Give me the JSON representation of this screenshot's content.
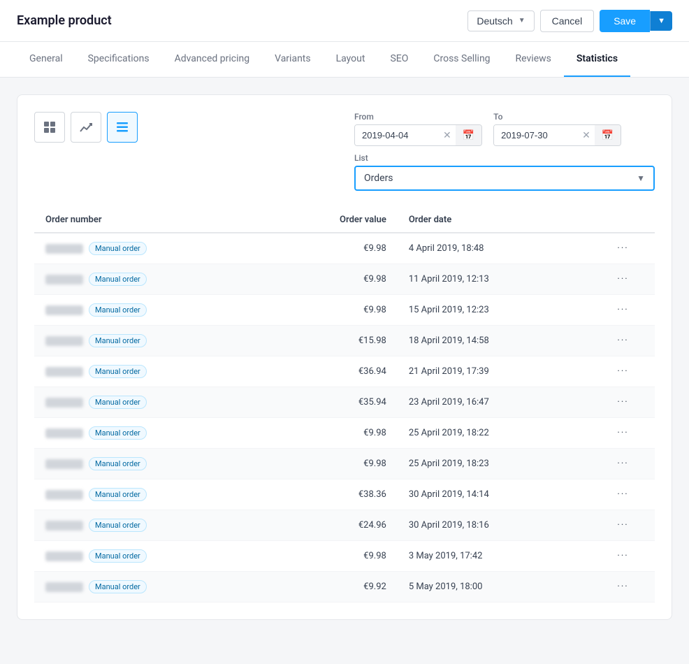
{
  "header": {
    "title": "Example product",
    "language": "Deutsch",
    "cancel_label": "Cancel",
    "save_label": "Save"
  },
  "tabs": [
    {
      "id": "general",
      "label": "General",
      "active": false
    },
    {
      "id": "specifications",
      "label": "Specifications",
      "active": false
    },
    {
      "id": "advanced-pricing",
      "label": "Advanced pricing",
      "active": false
    },
    {
      "id": "variants",
      "label": "Variants",
      "active": false
    },
    {
      "id": "layout",
      "label": "Layout",
      "active": false
    },
    {
      "id": "seo",
      "label": "SEO",
      "active": false
    },
    {
      "id": "cross-selling",
      "label": "Cross Selling",
      "active": false
    },
    {
      "id": "reviews",
      "label": "Reviews",
      "active": false
    },
    {
      "id": "statistics",
      "label": "Statistics",
      "active": true
    }
  ],
  "filters": {
    "from_label": "From",
    "to_label": "To",
    "from_value": "2019-04-04",
    "to_value": "2019-07-30",
    "list_label": "List",
    "list_value": "Orders"
  },
  "table": {
    "columns": [
      {
        "id": "order_number",
        "label": "Order number"
      },
      {
        "id": "order_value",
        "label": "Order value"
      },
      {
        "id": "order_date",
        "label": "Order date"
      },
      {
        "id": "actions",
        "label": ""
      }
    ],
    "rows": [
      {
        "order_num": "",
        "badge": "Manual order",
        "value": "€9.98",
        "date": "4 April 2019, 18:48"
      },
      {
        "order_num": "",
        "badge": "Manual order",
        "value": "€9.98",
        "date": "11 April 2019, 12:13"
      },
      {
        "order_num": "",
        "badge": "Manual order",
        "value": "€9.98",
        "date": "15 April 2019, 12:23"
      },
      {
        "order_num": "",
        "badge": "Manual order",
        "value": "€15.98",
        "date": "18 April 2019, 14:58"
      },
      {
        "order_num": "",
        "badge": "Manual order",
        "value": "€36.94",
        "date": "21 April 2019, 17:39"
      },
      {
        "order_num": "",
        "badge": "Manual order",
        "value": "€35.94",
        "date": "23 April 2019, 16:47"
      },
      {
        "order_num": "",
        "badge": "Manual order",
        "value": "€9.98",
        "date": "25 April 2019, 18:22"
      },
      {
        "order_num": "",
        "badge": "Manual order",
        "value": "€9.98",
        "date": "25 April 2019, 18:23"
      },
      {
        "order_num": "",
        "badge": "Manual order",
        "value": "€38.36",
        "date": "30 April 2019, 14:14"
      },
      {
        "order_num": "",
        "badge": "Manual order",
        "value": "€24.96",
        "date": "30 April 2019, 18:16"
      },
      {
        "order_num": "",
        "badge": "Manual order",
        "value": "€9.98",
        "date": "3 May 2019, 17:42"
      },
      {
        "order_num": "",
        "badge": "Manual order",
        "value": "€9.92",
        "date": "5 May 2019, 18:00"
      }
    ]
  }
}
